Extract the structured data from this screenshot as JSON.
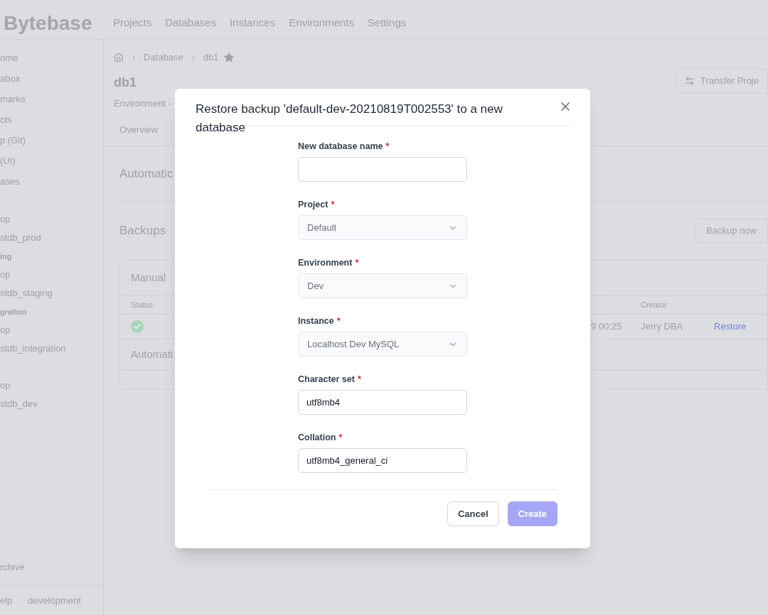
{
  "header": {
    "logo": "Bytebase",
    "nav": [
      "Projects",
      "Databases",
      "Instances",
      "Environments",
      "Settings"
    ]
  },
  "sidebar": {
    "groups": [
      {
        "items": [
          "ome",
          "abox",
          "marks",
          "cts",
          "p (Git)",
          "(UI)",
          "ases"
        ]
      },
      {
        "items": [
          "op",
          "stdb_prod"
        ]
      },
      {
        "header": "ing",
        "items": [
          "op",
          "stdb_staging"
        ]
      },
      {
        "header": "gration",
        "items": [
          "op",
          "stdb_integration"
        ]
      },
      {
        "items": [
          "op",
          "stdb_dev"
        ]
      }
    ],
    "archive": "rchive",
    "footer": [
      "elp",
      "development"
    ]
  },
  "page": {
    "breadcrumb": [
      "Database",
      "db1"
    ],
    "title": "db1",
    "subtitle": "Environment -",
    "tab": "Overview",
    "transfer_button": "Transfer Proje",
    "section_automatic": "Automatic",
    "backups_title": "Backups",
    "backup_button": "Backup now",
    "table": {
      "manual_title": "Manual",
      "columns": [
        "Status",
        "Creator"
      ],
      "row": {
        "time": "9 00:25",
        "creator": "Jerry DBA",
        "action": "Restore"
      },
      "automatic_title": "Automati"
    }
  },
  "dialog": {
    "title": "Restore backup 'default-dev-20210819T002553' to a new database",
    "fields": [
      {
        "label": "New database name",
        "kind": "text"
      },
      {
        "label": "Project",
        "kind": "select",
        "value": "Default",
        "disabled": true
      },
      {
        "label": "Environment",
        "kind": "select",
        "value": "Dev",
        "disabled": true
      },
      {
        "label": "Instance",
        "kind": "select",
        "value": "Localhost Dev MySQL",
        "disabled": true
      },
      {
        "label": "Character set",
        "kind": "text",
        "value": "utf8mb4"
      },
      {
        "label": "Collation",
        "kind": "text",
        "value": "utf8mb4_general_ci"
      }
    ],
    "required_mark": "*",
    "cancel": "Cancel",
    "create": "Create"
  }
}
